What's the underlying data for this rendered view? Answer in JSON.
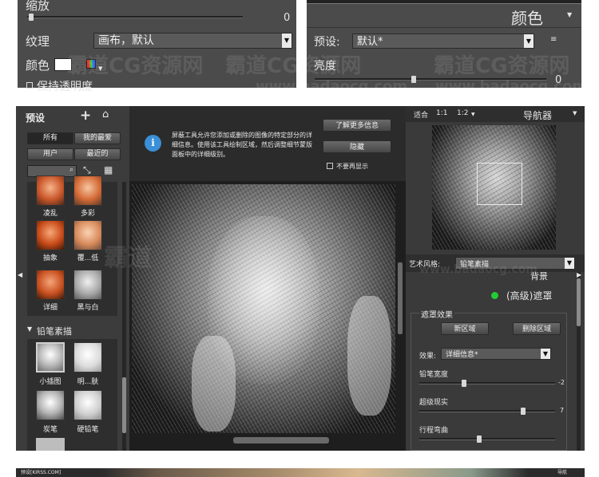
{
  "top_left_panel": {
    "scale_label": "缩放",
    "scale_value": "0",
    "texture_label": "纹理",
    "texture_value": "画布，默认",
    "color_label": "颜色",
    "keep_transparency_label": "保持透明度"
  },
  "top_right_panel": {
    "color_header": "颜色",
    "preset_label": "预设:",
    "preset_value": "默认*",
    "brightness_label": "亮度",
    "brightness_value": "0"
  },
  "watermarks": [
    "霸道CG资源网",
    "霸道CG资源网",
    "霸道CG资源网",
    "www.badaocg.com",
    "www.badaocg.com",
    "霸道",
    "www.badaocg.com"
  ],
  "left_sidebar": {
    "presets_title": "预设",
    "tabs": [
      "所有",
      "我的最爱",
      "用户",
      "最近的"
    ],
    "thumbs_top": [
      "凌乱",
      "多彩",
      "抽象",
      "覆...低",
      "详细",
      "黑与白"
    ],
    "section_title": "铅笔素描",
    "thumbs_bottom": [
      "小插图",
      "明...肤",
      "炭笔",
      "硬铅笔"
    ]
  },
  "info_bar": {
    "message": "屏蔽工具允许您添加或删除的图像的特定部分的详细信息。使用该工具绘制区域，然后调整细节蒙版面板中的详细级别。",
    "learn_more": "了解更多信息",
    "hide": "隐藏",
    "dont_show": "不要再显示"
  },
  "right_panel": {
    "zoom_fit": "适合",
    "zoom_1_1": "1:1",
    "zoom_1_2": "1:2",
    "navigator": "导航器",
    "art_style_label": "艺术风格:",
    "art_style_value": "铅笔素描",
    "background_label": "背景",
    "advanced_mask": "(高级)遮罩",
    "mask_effect_title": "遮罩效果",
    "new_region": "新区域",
    "delete_region": "删除区域",
    "effect_label": "效果:",
    "effect_value": "详细信息*",
    "pencil_width_label": "铅笔宽度",
    "pencil_width_value": "-2",
    "super_real_label": "超级现实",
    "super_real_value": "7",
    "stroke_bend_label": "行程弯曲"
  },
  "bottom_strip": {
    "left_text": "预设[KIRSS.COM]",
    "right_text": "导航"
  },
  "colors": {
    "panel": "#4a4a4a",
    "dark": "#2b2b2b",
    "accent_green": "#22cc33",
    "info_blue": "#3a8fd6"
  }
}
